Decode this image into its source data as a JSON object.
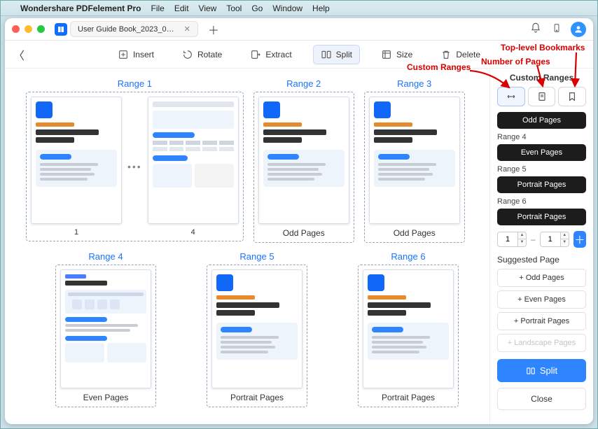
{
  "menu": {
    "apple": "",
    "app": "Wondershare PDFelement Pro",
    "items": [
      "File",
      "Edit",
      "View",
      "Tool",
      "Go",
      "Window",
      "Help"
    ]
  },
  "tab": {
    "title": "User Guide Book_2023_0…"
  },
  "toolbar": {
    "insert": "Insert",
    "rotate": "Rotate",
    "extract": "Extract",
    "split": "Split",
    "size": "Size",
    "delete": "Delete"
  },
  "ranges": {
    "r1": "Range 1",
    "r2": "Range 2",
    "r3": "Range 3",
    "r4": "Range 4",
    "r5": "Range 5",
    "r6": "Range 6",
    "p1": "1",
    "p4": "4",
    "odd": "Odd Pages",
    "even": "Even Pages",
    "portrait": "Portrait Pages"
  },
  "panel": {
    "title": "Custom Ranges",
    "odd": "Odd Pages",
    "even": "Even Pages",
    "portrait": "Portrait Pages",
    "r4": "Range 4",
    "r5": "Range 5",
    "r6": "Range 6",
    "from": "1",
    "to": "1",
    "suggTitle": "Suggested Page",
    "sOdd": "+  Odd Pages",
    "sEven": "+  Even Pages",
    "sPortrait": "+  Portrait Pages",
    "sLandscape": "+  Landscape Pages",
    "split": "Split",
    "close": "Close"
  },
  "annotations": {
    "custom": "Custom Ranges",
    "pages": "Number of Pages",
    "bookmarks": "Top-level Bookmarks"
  }
}
